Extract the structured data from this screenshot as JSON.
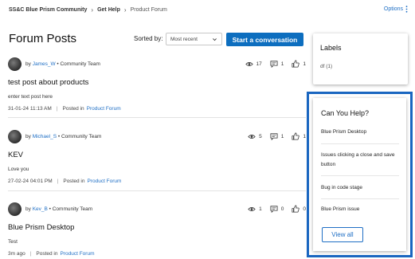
{
  "breadcrumb": {
    "items": [
      "SS&C Blue Prism Community",
      "Get Help",
      "Product Forum"
    ],
    "separator": "›"
  },
  "options": {
    "label": "Options",
    "icon": "kebab-icon"
  },
  "header": {
    "title": "Forum Posts",
    "sort_label": "Sorted by:",
    "sort_value": "Most recent",
    "start_button": "Start a conversation"
  },
  "posts": [
    {
      "by": "by",
      "author": "James_W",
      "role": "• Community Team",
      "views": "17",
      "replies": "1",
      "likes": "1",
      "title": "test post about products",
      "body": "enter text post here",
      "date": "31-01-24 11:13 AM",
      "posted_in": "Posted in",
      "forum": "Product Forum"
    },
    {
      "by": "by",
      "author": "Michael_S",
      "role": "• Community Team",
      "views": "5",
      "replies": "1",
      "likes": "1",
      "title": "KEV",
      "body": "Love you",
      "date": "27-02-24 04:01 PM",
      "posted_in": "Posted in",
      "forum": "Product Forum"
    },
    {
      "by": "by",
      "author": "Kev_B",
      "role": "• Community Team",
      "views": "1",
      "replies": "0",
      "likes": "0",
      "title": "Blue Prism Desktop",
      "body": "Test",
      "date": "3m ago",
      "posted_in": "Posted in",
      "forum": "Product Forum"
    }
  ],
  "labels": {
    "title": "Labels",
    "items": [
      "df (1)"
    ]
  },
  "help": {
    "title": "Can You Help?",
    "items": [
      "Blue Prism Desktop",
      "Issues clicking a close and save button",
      "Bug in code stage",
      "Blue Prism issue"
    ],
    "view_all": "View all"
  },
  "colors": {
    "accent": "#0d6ebf",
    "link": "#1f6fc5",
    "highlight_border": "#1a66c0"
  }
}
